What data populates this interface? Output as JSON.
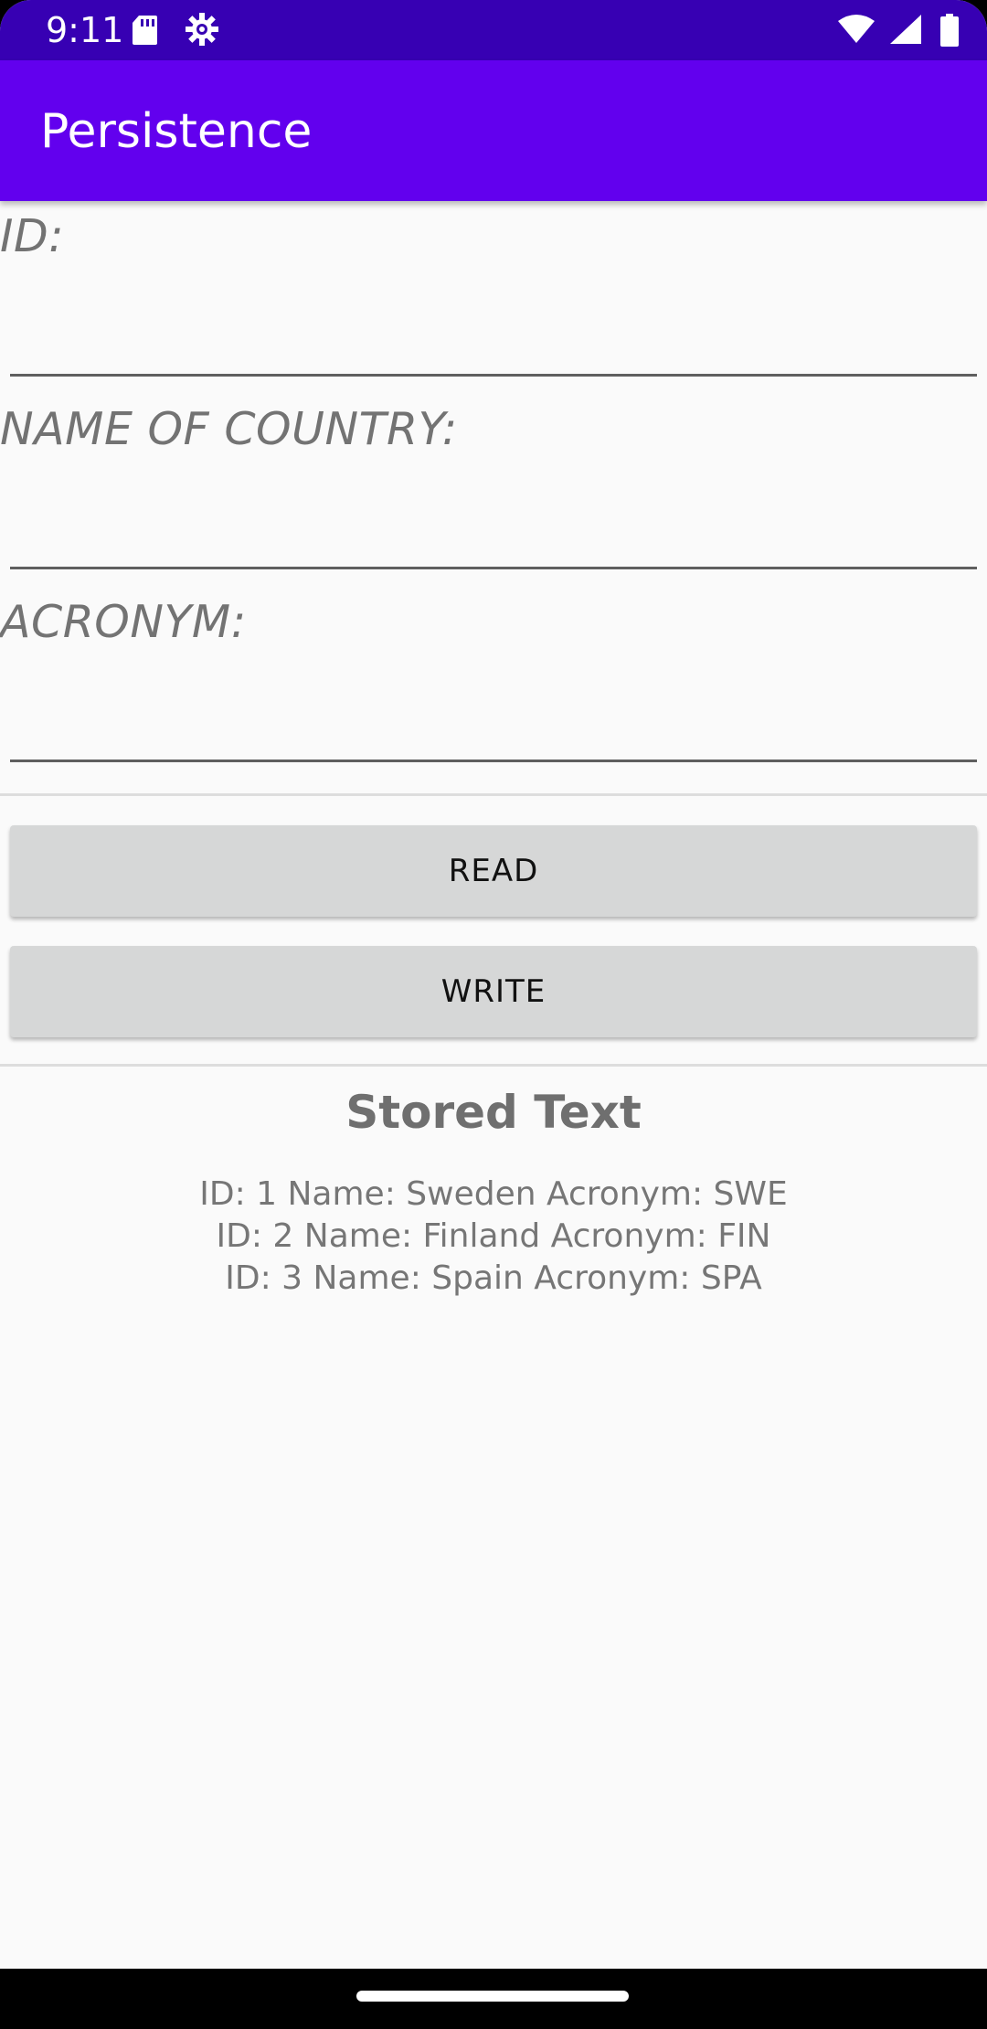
{
  "status_bar": {
    "time": "9:11",
    "left_icons": [
      "sd-card-icon",
      "settings-gear-icon"
    ],
    "right_icons": [
      "wifi-icon",
      "signal-icon",
      "battery-icon"
    ]
  },
  "app_bar": {
    "title": "Persistence"
  },
  "form": {
    "id_label": "ID:",
    "id_value": "",
    "country_label": "NAME OF COUNTRY:",
    "country_value": "",
    "acronym_label": "ACRONYM:",
    "acronym_value": ""
  },
  "buttons": {
    "read": "READ",
    "write": "WRITE"
  },
  "stored": {
    "title": "Stored Text",
    "lines": [
      "ID: 1 Name: Sweden Acronym: SWE",
      "ID: 2 Name: Finland Acronym: FIN",
      "ID: 3 Name: Spain Acronym: SPA"
    ]
  },
  "colors": {
    "status_bar": "#3700b3",
    "app_bar": "#6200ee",
    "background": "#fafafa",
    "button": "#d6d7d7"
  }
}
